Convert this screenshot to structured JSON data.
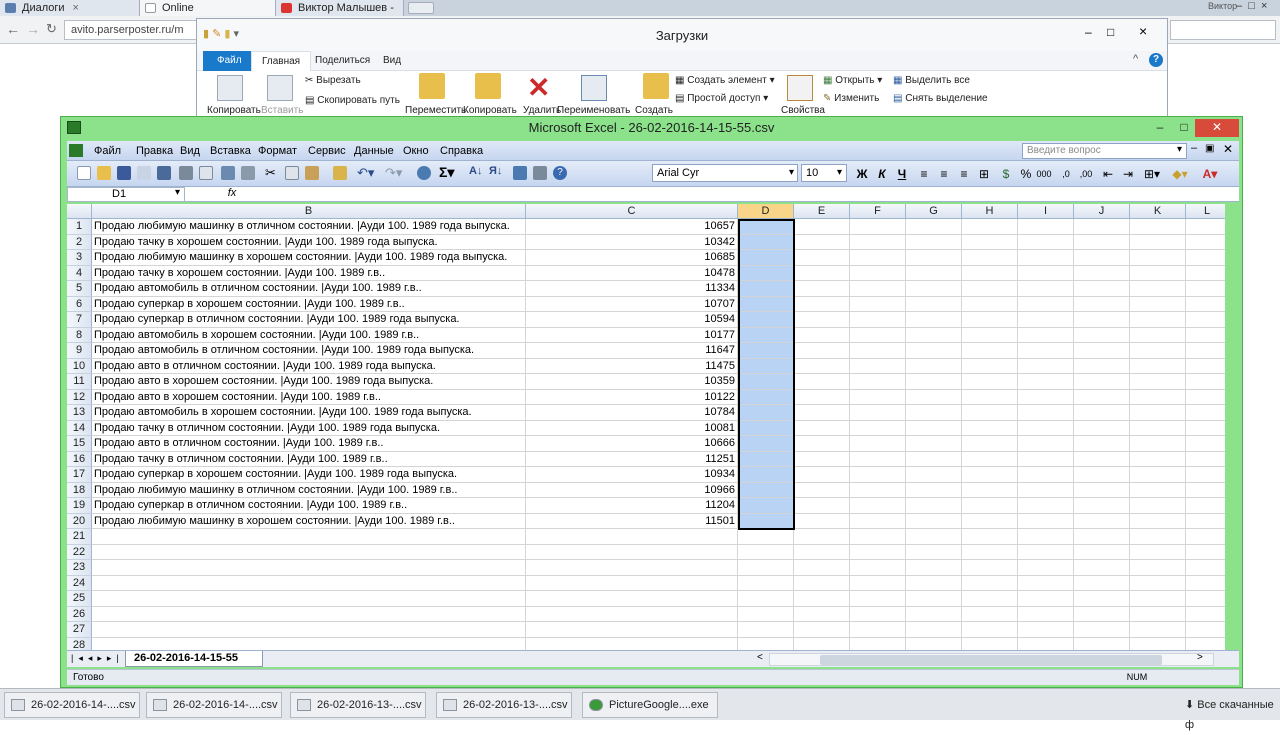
{
  "browser": {
    "tabs": [
      {
        "label": "Диалоги"
      },
      {
        "label": "Online рандомайзер"
      },
      {
        "label": "Виктор Малышев - "
      }
    ],
    "user": "Виктор",
    "url": "avito.parserposter.ru/m"
  },
  "explorer": {
    "title": "Загрузки",
    "tabs": [
      "Файл",
      "Главная",
      "Поделиться",
      "Вид"
    ],
    "buttons": {
      "copy": "Копировать",
      "paste": "Вставить",
      "cut": "Вырезать",
      "copy_path": "Скопировать путь",
      "move": "Переместить",
      "copy2": "Копировать",
      "delete": "Удалить",
      "rename": "Переименовать",
      "create": "Создать",
      "new_item": "Создать элемент ▾",
      "easy_access": "Простой доступ ▾",
      "properties": "Свойства",
      "open": "Открыть ▾",
      "edit": "Изменить",
      "select_all": "Выделить все",
      "deselect": "Снять выделение"
    }
  },
  "excel": {
    "title": "Microsoft Excel - 26-02-2016-14-15-55.csv",
    "menu": [
      "Файл",
      "Правка",
      "Вид",
      "Вставка",
      "Формат",
      "Сервис",
      "Данные",
      "Окно",
      "Справка"
    ],
    "help_placeholder": "Введите вопрос",
    "font": "Arial Cyr",
    "font_size": "10",
    "name_box": "D1",
    "fx": "fx",
    "columns": [
      "B",
      "C",
      "D",
      "E",
      "F",
      "G",
      "H",
      "I",
      "J",
      "K",
      "L"
    ],
    "selected_column": "D",
    "rows": [
      {
        "n": "1",
        "b": "Продаю любимую машинку в отличном состоянии. |Ауди 100. 1989 года выпуска.",
        "c": "10657"
      },
      {
        "n": "2",
        "b": "Продаю тачку в хорошем состоянии. |Ауди 100. 1989 года выпуска.",
        "c": "10342"
      },
      {
        "n": "3",
        "b": "Продаю любимую машинку в хорошем состоянии. |Ауди 100. 1989 года выпуска.",
        "c": "10685"
      },
      {
        "n": "4",
        "b": "Продаю тачку в хорошем состоянии. |Ауди 100. 1989 г.в..",
        "c": "10478"
      },
      {
        "n": "5",
        "b": "Продаю автомобиль в отличном состоянии. |Ауди 100. 1989 г.в..",
        "c": "11334"
      },
      {
        "n": "6",
        "b": "Продаю суперкар в хорошем состоянии. |Ауди 100. 1989 г.в..",
        "c": "10707"
      },
      {
        "n": "7",
        "b": "Продаю суперкар в отличном состоянии. |Ауди 100. 1989 года выпуска.",
        "c": "10594"
      },
      {
        "n": "8",
        "b": "Продаю автомобиль в хорошем состоянии. |Ауди 100. 1989 г.в..",
        "c": "10177"
      },
      {
        "n": "9",
        "b": "Продаю автомобиль в отличном состоянии. |Ауди 100. 1989 года выпуска.",
        "c": "11647"
      },
      {
        "n": "10",
        "b": "Продаю авто в отличном состоянии. |Ауди 100. 1989 года выпуска.",
        "c": "11475"
      },
      {
        "n": "11",
        "b": "Продаю авто в хорошем состоянии. |Ауди 100. 1989 года выпуска.",
        "c": "10359"
      },
      {
        "n": "12",
        "b": "Продаю авто в хорошем состоянии. |Ауди 100. 1989 г.в..",
        "c": "10122"
      },
      {
        "n": "13",
        "b": "Продаю автомобиль в хорошем состоянии. |Ауди 100. 1989 года выпуска.",
        "c": "10784"
      },
      {
        "n": "14",
        "b": "Продаю тачку в отличном состоянии. |Ауди 100. 1989 года выпуска.",
        "c": "10081"
      },
      {
        "n": "15",
        "b": "Продаю авто в отличном состоянии. |Ауди 100. 1989 г.в..",
        "c": "10666"
      },
      {
        "n": "16",
        "b": "Продаю тачку в отличном состоянии. |Ауди 100. 1989 г.в..",
        "c": "11251"
      },
      {
        "n": "17",
        "b": "Продаю суперкар в хорошем состоянии. |Ауди 100. 1989 года выпуска.",
        "c": "10934"
      },
      {
        "n": "18",
        "b": "Продаю любимую машинку в отличном состоянии. |Ауди 100. 1989 г.в..",
        "c": "10966"
      },
      {
        "n": "19",
        "b": "Продаю суперкар в отличном состоянии. |Ауди 100. 1989 г.в..",
        "c": "11204"
      },
      {
        "n": "20",
        "b": "Продаю любимую машинку в хорошем состоянии. |Ауди 100. 1989 г.в..",
        "c": "11501"
      },
      {
        "n": "21",
        "b": "",
        "c": ""
      },
      {
        "n": "22",
        "b": "",
        "c": ""
      },
      {
        "n": "23",
        "b": "",
        "c": ""
      },
      {
        "n": "24",
        "b": "",
        "c": ""
      },
      {
        "n": "25",
        "b": "",
        "c": ""
      },
      {
        "n": "26",
        "b": "",
        "c": ""
      },
      {
        "n": "27",
        "b": "",
        "c": ""
      },
      {
        "n": "28",
        "b": "",
        "c": ""
      }
    ],
    "sheet_tab": "26-02-2016-14-15-55",
    "status": "Готово",
    "num_indicator": "NUM"
  },
  "taskbar": {
    "items": [
      {
        "label": "26-02-2016-14-....csv"
      },
      {
        "label": "26-02-2016-14-....csv"
      },
      {
        "label": "26-02-2016-13-....csv"
      },
      {
        "label": "26-02-2016-13-....csv"
      },
      {
        "label": "PictureGoogle....exe"
      }
    ],
    "show_all": "Все скачанные ф"
  },
  "colors": {
    "excel_frame": "#8be28b",
    "selection": "#b8d3f3",
    "header_selected": "#f9d58a",
    "explorer_file_tab": "#1979ca",
    "close_button": "#d84a3a"
  }
}
